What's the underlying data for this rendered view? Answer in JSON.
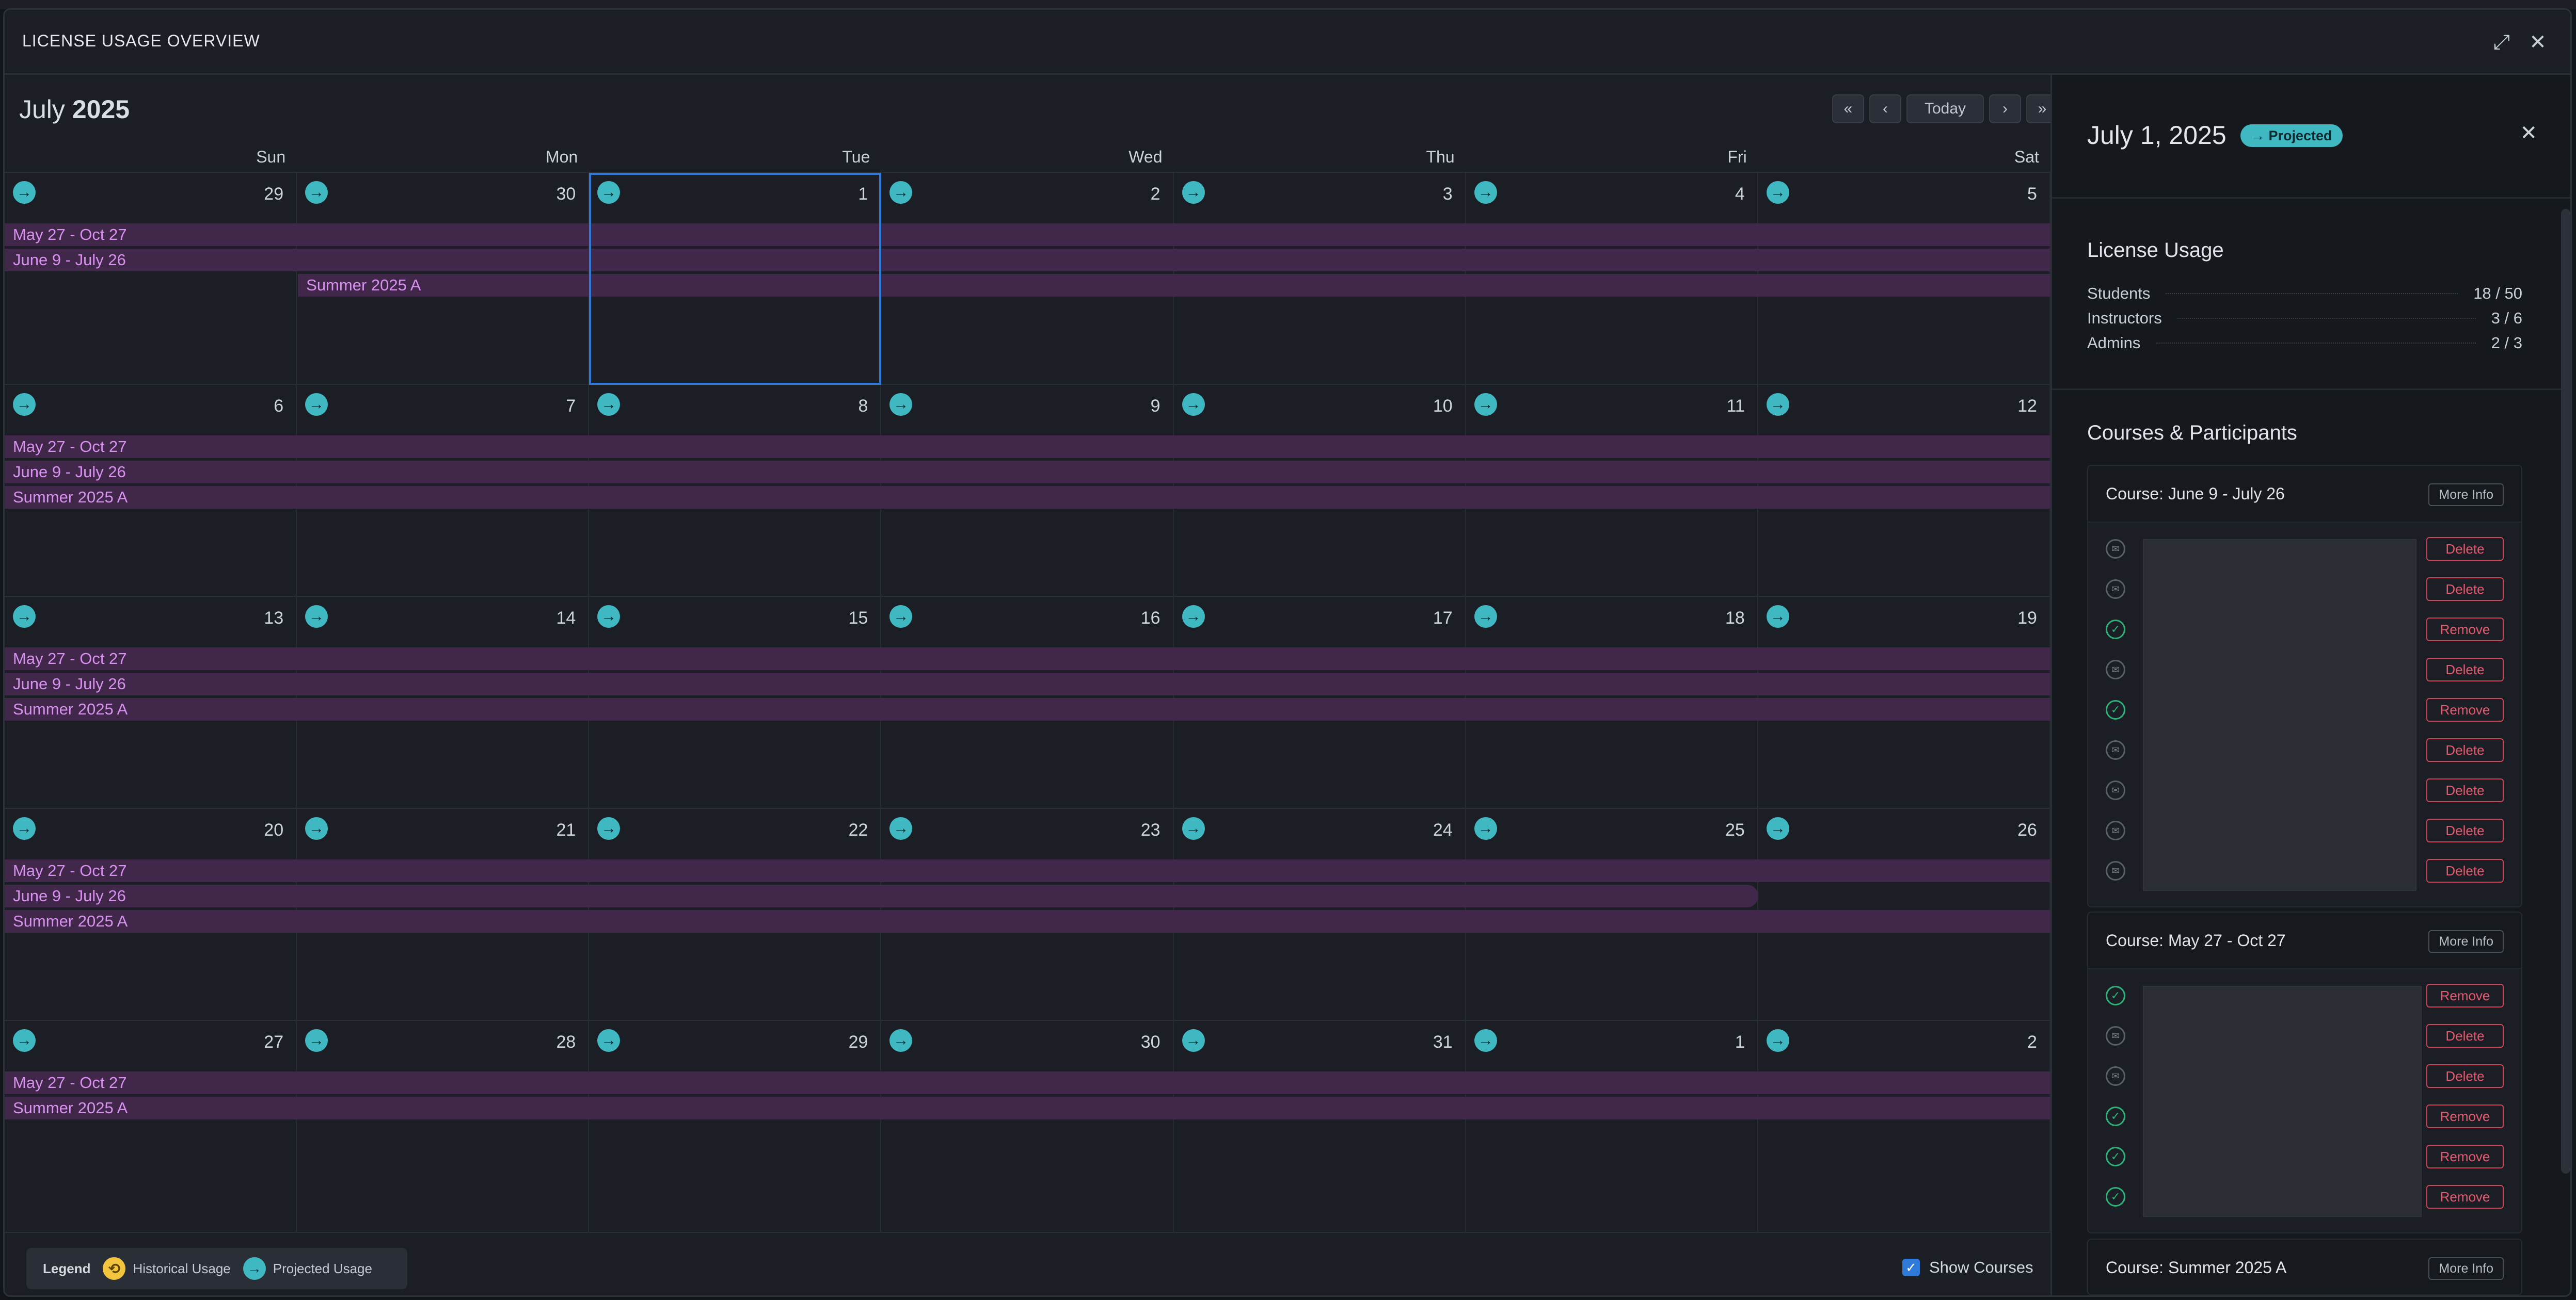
{
  "modal": {
    "title": "LICENSE USAGE OVERVIEW"
  },
  "calendar": {
    "month": "July",
    "year": "2025",
    "nav": {
      "first": "«",
      "prev": "‹",
      "today": "Today",
      "next": "›",
      "last": "»"
    },
    "weekdays": [
      "Sun",
      "Mon",
      "Tue",
      "Wed",
      "Thu",
      "Fri",
      "Sat"
    ],
    "weeks": [
      [
        "29",
        "30",
        "1",
        "2",
        "3",
        "4",
        "5"
      ],
      [
        "6",
        "7",
        "8",
        "9",
        "10",
        "11",
        "12"
      ],
      [
        "13",
        "14",
        "15",
        "16",
        "17",
        "18",
        "19"
      ],
      [
        "20",
        "21",
        "22",
        "23",
        "24",
        "25",
        "26"
      ],
      [
        "27",
        "28",
        "29",
        "30",
        "31",
        "1",
        "2"
      ]
    ],
    "course_bars": {
      "may_oct": "May 27 - Oct 27",
      "june_july": "June 9 - July 26",
      "summer": "Summer 2025 A"
    }
  },
  "legend": {
    "title": "Legend",
    "historical": "Historical Usage",
    "projected": "Projected Usage"
  },
  "show_courses": {
    "label": "Show Courses",
    "checked": true
  },
  "panel": {
    "date": "July 1, 2025",
    "badge": "→ Projected",
    "license_usage": {
      "title": "License Usage",
      "rows": [
        {
          "label": "Students",
          "value": "18 / 50"
        },
        {
          "label": "Instructors",
          "value": "3 / 6"
        },
        {
          "label": "Admins",
          "value": "2 / 3"
        }
      ]
    },
    "courses_title": "Courses & Participants",
    "courses": [
      {
        "title": "Course: June 9 - July 26",
        "more": "More Info",
        "actions": [
          "Delete",
          "Delete",
          "Remove",
          "Delete",
          "Remove",
          "Delete",
          "Delete",
          "Delete",
          "Delete"
        ]
      },
      {
        "title": "Course: May 27 - Oct 27",
        "more": "More Info",
        "actions": [
          "Remove",
          "Delete",
          "Delete",
          "Remove",
          "Remove",
          "Remove"
        ]
      },
      {
        "title": "Course: Summer 2025 A",
        "more": "More Info",
        "actions": []
      }
    ]
  },
  "colors": {
    "accent": "#3fb8c2",
    "course_bar": "#41284b",
    "course_text": "#d991f0",
    "selected": "#2f7ad8",
    "danger": "#e45b70"
  }
}
